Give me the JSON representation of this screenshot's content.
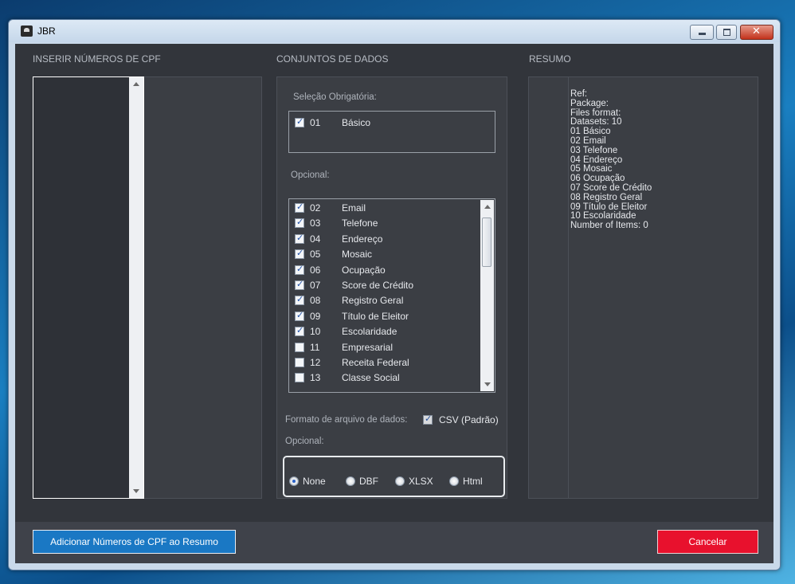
{
  "window": {
    "title": "JBR"
  },
  "cpf": {
    "section_label": "INSERIR NÚMEROS DE CPF"
  },
  "datasets": {
    "section_label": "CONJUNTOS DE DADOS",
    "required_label": "Seleção Obrigatória:",
    "required_items": [
      {
        "num": "01",
        "label": "Básico",
        "checked": true
      }
    ],
    "optional_label": "Opcional:",
    "optional_items": [
      {
        "num": "02",
        "label": "Email",
        "checked": true
      },
      {
        "num": "03",
        "label": "Telefone",
        "checked": true
      },
      {
        "num": "04",
        "label": "Endereço",
        "checked": true
      },
      {
        "num": "05",
        "label": "Mosaic",
        "checked": true
      },
      {
        "num": "06",
        "label": "Ocupação",
        "checked": true
      },
      {
        "num": "07",
        "label": "Score de Crédito",
        "checked": true
      },
      {
        "num": "08",
        "label": "Registro Geral",
        "checked": true
      },
      {
        "num": "09",
        "label": "Título de Eleitor",
        "checked": true
      },
      {
        "num": "10",
        "label": "Escolaridade",
        "checked": true
      },
      {
        "num": "11",
        "label": "Empresarial",
        "checked": false
      },
      {
        "num": "12",
        "label": "Receita Federal",
        "checked": false
      },
      {
        "num": "13",
        "label": "Classe Social",
        "checked": false
      }
    ],
    "format_label": "Formato de arquivo de dados:",
    "format_default": "CSV (Padrão)",
    "format_optional_label": "Opcional:",
    "format_options": [
      {
        "label": "None",
        "selected": true
      },
      {
        "label": "DBF",
        "selected": false
      },
      {
        "label": "XLSX",
        "selected": false
      },
      {
        "label": "Html",
        "selected": false
      }
    ]
  },
  "summary": {
    "section_label": "RESUMO",
    "lines": [
      "Ref:",
      "Package:",
      "Files format:",
      "Datasets: 10",
      "01 Básico",
      "02 Email",
      "03 Telefone",
      "04 Endereço",
      "05 Mosaic",
      "06 Ocupação",
      "07 Score de Crédito",
      "08 Registro Geral",
      "09 Título de Eleitor",
      "10 Escolaridade",
      "Number of Items: 0"
    ]
  },
  "actions": {
    "add_label": "Adicionar Números de CPF ao Resumo",
    "cancel_label": "Cancelar"
  },
  "colors": {
    "accent": "#1a78c4",
    "danger": "#e8112d",
    "background": "#32353b"
  }
}
